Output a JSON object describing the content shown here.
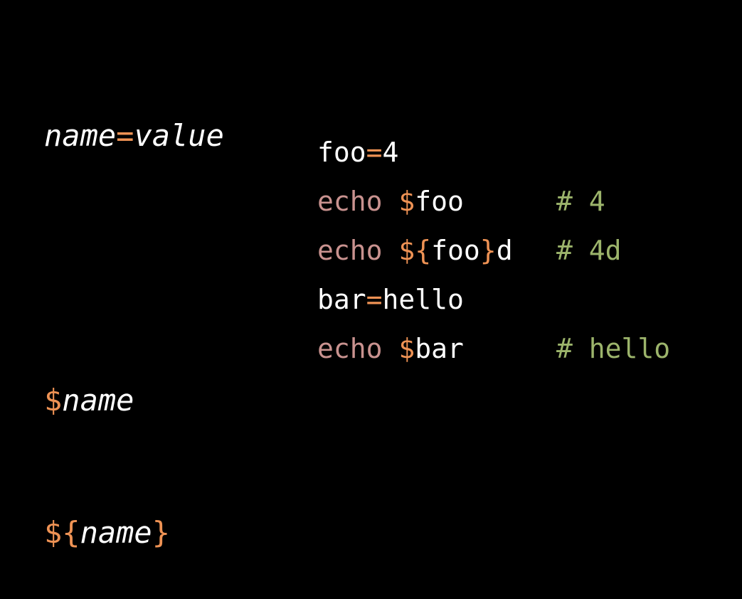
{
  "colors": {
    "background": "#000000",
    "text": "#ffffff",
    "operator": "#ee9254",
    "keyword": "#c9928f",
    "comment": "#9cb46b"
  },
  "syntax": {
    "assign": {
      "name": "name",
      "op": "=",
      "value": "value"
    },
    "ref_simple": {
      "sigil": "$",
      "name": "name"
    },
    "ref_braced": {
      "open": "${",
      "name": "name",
      "close": "}"
    }
  },
  "code": [
    {
      "parts": [
        {
          "t": "foo",
          "c": "w"
        },
        {
          "t": "=",
          "c": "o"
        },
        {
          "t": "4",
          "c": "w"
        }
      ]
    },
    {
      "parts": [
        {
          "t": "echo ",
          "c": "k"
        },
        {
          "t": "$",
          "c": "o"
        },
        {
          "t": "foo",
          "c": "w"
        }
      ],
      "comment": "# 4"
    },
    {
      "parts": [
        {
          "t": "echo ",
          "c": "k"
        },
        {
          "t": "${",
          "c": "o"
        },
        {
          "t": "foo",
          "c": "w"
        },
        {
          "t": "}",
          "c": "o"
        },
        {
          "t": "d",
          "c": "w"
        }
      ],
      "comment": "# 4d"
    },
    {
      "parts": [
        {
          "t": "bar",
          "c": "w"
        },
        {
          "t": "=",
          "c": "o"
        },
        {
          "t": "hello",
          "c": "w"
        }
      ]
    },
    {
      "parts": [
        {
          "t": "echo ",
          "c": "k"
        },
        {
          "t": "$",
          "c": "o"
        },
        {
          "t": "bar",
          "c": "w"
        }
      ],
      "comment": "# hello"
    }
  ]
}
